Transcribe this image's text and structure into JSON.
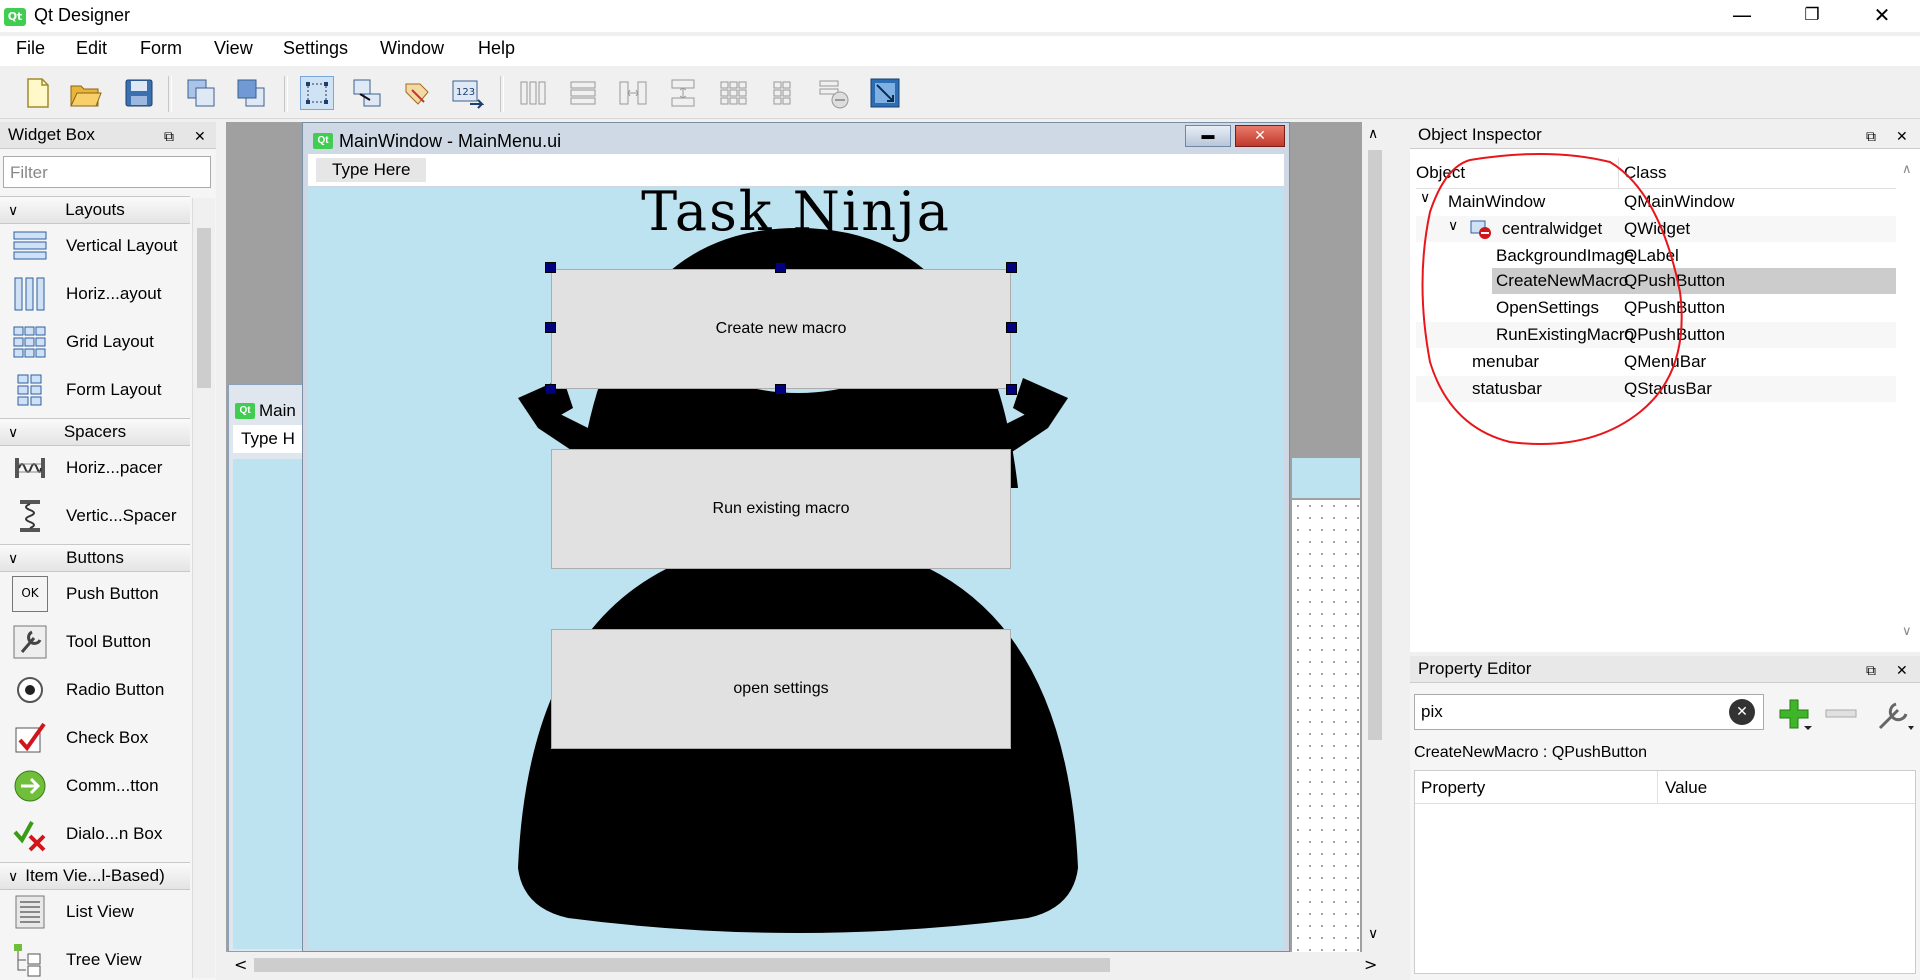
{
  "window": {
    "title": "Qt Designer",
    "app_icon_text": "Qt",
    "minimize": "—",
    "restore": "❐",
    "close": "✕"
  },
  "menu": [
    "File",
    "Edit",
    "Form",
    "View",
    "Settings",
    "Window",
    "Help"
  ],
  "toolbar_icons": [
    "new-form-icon",
    "open-form-icon",
    "save-form-icon",
    "send-to-back-icon",
    "bring-to-front-icon",
    "edit-widgets-icon",
    "edit-signals-slots-icon",
    "edit-buddies-icon",
    "edit-tab-order-icon",
    "lay-out-horizontally-icon",
    "lay-out-vertically-icon",
    "lay-out-horizontal-splitter-icon",
    "lay-out-vertical-splitter-icon",
    "lay-out-grid-icon",
    "lay-out-form-icon",
    "break-layout-icon",
    "adjust-size-icon"
  ],
  "widget_box": {
    "title": "Widget Box",
    "filter_placeholder": "Filter",
    "categories": {
      "layouts": "Layouts",
      "spacers": "Spacers",
      "buttons": "Buttons",
      "item_views": "Item Vie...l-Based)"
    },
    "items": {
      "vertical_layout": "Vertical Layout",
      "horizontal_layout": "Horiz...ayout",
      "grid_layout": "Grid Layout",
      "form_layout": "Form Layout",
      "horizontal_spacer": "Horiz...pacer",
      "vertical_spacer": "Vertic...Spacer",
      "push_button": "Push Button",
      "tool_button": "Tool Button",
      "radio_button": "Radio Button",
      "check_box": "Check Box",
      "command_button": "Comm...tton",
      "dialog_button_box": "Dialo...n Box",
      "list_view": "List View",
      "tree_view": "Tree View"
    },
    "ok_icon_text": "OK"
  },
  "form": {
    "title": "MainWindow - MainMenu.ui",
    "icon_text": "Qt",
    "type_here": "Type Here",
    "heading": "Task Ninja",
    "buttons": {
      "create": "Create new macro",
      "run": "Run existing macro",
      "settings": "open settings"
    },
    "back_window_title": "Main",
    "back_type_here": "Type H"
  },
  "object_inspector": {
    "title": "Object Inspector",
    "col_object": "Object",
    "col_class": "Class",
    "rows": [
      {
        "name": "MainWindow",
        "cls": "QMainWindow"
      },
      {
        "name": "centralwidget",
        "cls": "QWidget"
      },
      {
        "name": "BackgroundImage",
        "cls": "QLabel"
      },
      {
        "name": "CreateNewMacro",
        "cls": "QPushButton"
      },
      {
        "name": "OpenSettings",
        "cls": "QPushButton"
      },
      {
        "name": "RunExistingMacro",
        "cls": "QPushButton"
      },
      {
        "name": "menubar",
        "cls": "QMenuBar"
      },
      {
        "name": "statusbar",
        "cls": "QStatusBar"
      }
    ],
    "selected": "CreateNewMacro",
    "annotation_color": "#e8161b"
  },
  "property_editor": {
    "title": "Property Editor",
    "filter_value": "pix",
    "object_label": "CreateNewMacro : QPushButton",
    "col_property": "Property",
    "col_value": "Value"
  },
  "colors": {
    "form_bg": "#bde3f0",
    "selection": "#cccccc",
    "handles": "#000080"
  }
}
